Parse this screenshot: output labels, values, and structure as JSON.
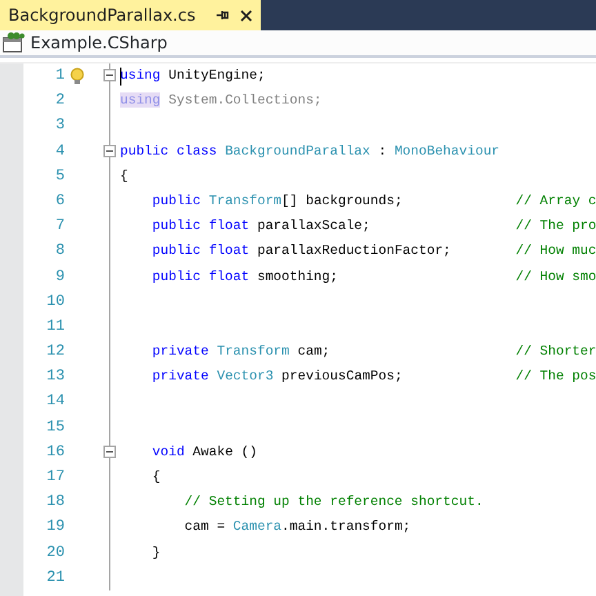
{
  "tab": {
    "title": "BackgroundParallax.cs",
    "selected": true
  },
  "navigation": {
    "project": "Example.CSharp"
  },
  "lines": [
    {
      "number": "1",
      "fold_toggle": {
        "expanded": true
      },
      "bulb": true,
      "tokens": [
        {
          "t": "using",
          "kind": "keyword"
        },
        {
          "t": " UnityEngine;",
          "kind": "plain"
        }
      ]
    },
    {
      "number": "2",
      "tokens": [
        {
          "t": "using",
          "kind": "unusedkeyword"
        },
        {
          "t": " System.Collections;",
          "kind": "unused"
        }
      ]
    },
    {
      "number": "3"
    },
    {
      "number": "4",
      "fold_toggle": {
        "expanded": true
      },
      "tokens": [
        {
          "t": "public class ",
          "kind": "keyword"
        },
        {
          "t": "BackgroundParallax",
          "kind": "type"
        },
        {
          "t": " : ",
          "kind": "plain"
        },
        {
          "t": "MonoBehaviour",
          "kind": "type"
        }
      ]
    },
    {
      "number": "5",
      "tokens": [
        {
          "t": "{",
          "kind": "plain"
        }
      ]
    },
    {
      "number": "6",
      "tokens": [
        {
          "t": "    public ",
          "kind": "keyword"
        },
        {
          "t": "Transform",
          "kind": "type"
        },
        {
          "t": "[] backgrounds;              ",
          "kind": "plain"
        },
        {
          "t": "// Array c",
          "kind": "comment"
        }
      ]
    },
    {
      "number": "7",
      "tokens": [
        {
          "t": "    public float",
          "kind": "keyword"
        },
        {
          "t": " parallaxScale;                  ",
          "kind": "plain"
        },
        {
          "t": "// The pro",
          "kind": "comment"
        }
      ]
    },
    {
      "number": "8",
      "tokens": [
        {
          "t": "    public float",
          "kind": "keyword"
        },
        {
          "t": " parallaxReductionFactor;        ",
          "kind": "plain"
        },
        {
          "t": "// How muc",
          "kind": "comment"
        }
      ]
    },
    {
      "number": "9",
      "tokens": [
        {
          "t": "    public float",
          "kind": "keyword"
        },
        {
          "t": " smoothing;                      ",
          "kind": "plain"
        },
        {
          "t": "// How smo",
          "kind": "comment"
        }
      ]
    },
    {
      "number": "10"
    },
    {
      "number": "11"
    },
    {
      "number": "12",
      "tokens": [
        {
          "t": "    private ",
          "kind": "keyword"
        },
        {
          "t": "Transform",
          "kind": "type"
        },
        {
          "t": " cam;                       ",
          "kind": "plain"
        },
        {
          "t": "// Shorter",
          "kind": "comment"
        }
      ]
    },
    {
      "number": "13",
      "tokens": [
        {
          "t": "    private ",
          "kind": "keyword"
        },
        {
          "t": "Vector3",
          "kind": "type"
        },
        {
          "t": " previousCamPos;              ",
          "kind": "plain"
        },
        {
          "t": "// The pos",
          "kind": "comment"
        }
      ]
    },
    {
      "number": "14"
    },
    {
      "number": "15"
    },
    {
      "number": "16",
      "fold_toggle": {
        "expanded": true
      },
      "tokens": [
        {
          "t": "    void",
          "kind": "keyword"
        },
        {
          "t": " Awake ()",
          "kind": "plain"
        }
      ]
    },
    {
      "number": "17",
      "tokens": [
        {
          "t": "    {",
          "kind": "plain"
        }
      ]
    },
    {
      "number": "18",
      "tokens": [
        {
          "t": "        // Setting up the reference shortcut.",
          "kind": "comment"
        }
      ]
    },
    {
      "number": "19",
      "tokens": [
        {
          "t": "        cam = ",
          "kind": "plain"
        },
        {
          "t": "Camera",
          "kind": "type"
        },
        {
          "t": ".main.transform;",
          "kind": "plain"
        }
      ]
    },
    {
      "number": "20",
      "tokens": [
        {
          "t": "    }",
          "kind": "plain"
        }
      ]
    },
    {
      "number": "21"
    }
  ]
}
